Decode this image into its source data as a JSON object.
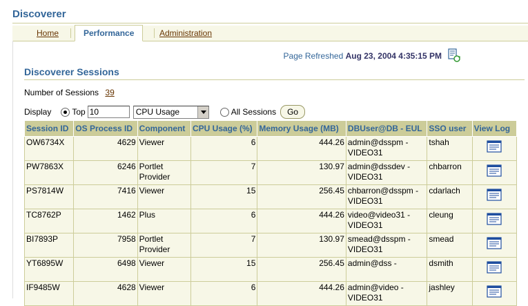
{
  "app": {
    "title": "Discoverer"
  },
  "tabs": [
    {
      "label": "Home",
      "active": false
    },
    {
      "label": "Performance",
      "active": true
    },
    {
      "label": "Administration",
      "active": false
    }
  ],
  "refresh": {
    "label": "Page Refreshed",
    "timestamp": "Aug 23, 2004 4:35:15 PM",
    "icon": "refresh-icon"
  },
  "section": {
    "title": "Discoverer Sessions"
  },
  "num_sessions": {
    "label": "Number of Sessions",
    "value": "39"
  },
  "display": {
    "label": "Display",
    "top_label": "Top",
    "top_value": "10",
    "sort_by": "CPU Usage",
    "all_label": "All Sessions",
    "go_label": "Go",
    "selected": "top"
  },
  "table": {
    "headers": [
      "Session ID",
      "OS Process ID",
      "Component",
      "CPU Usage (%)",
      "Memory Usage (MB)",
      "DBUser@DB - EUL",
      "SSO user",
      "View Log"
    ],
    "rows": [
      {
        "session_id": "OW6734X",
        "os_pid": "4629",
        "component": "Viewer",
        "cpu": "6",
        "memory": "444.26",
        "dbuser": "admin@dsspm - VIDEO31",
        "sso": "tshah"
      },
      {
        "session_id": "PW7863X",
        "os_pid": "6246",
        "component": "Portlet Provider",
        "cpu": "7",
        "memory": "130.97",
        "dbuser": "admin@dssdev - VIDEO31",
        "sso": "chbarron"
      },
      {
        "session_id": "PS7814W",
        "os_pid": "7416",
        "component": "Viewer",
        "cpu": "15",
        "memory": "256.45",
        "dbuser": "chbarron@dsspm - VIDEO31",
        "sso": "cdarlach"
      },
      {
        "session_id": "TC8762P",
        "os_pid": "1462",
        "component": "Plus",
        "cpu": "6",
        "memory": "444.26",
        "dbuser": "video@video31 - VIDEO31",
        "sso": "cleung"
      },
      {
        "session_id": "BI7893P",
        "os_pid": "7958",
        "component": "Portlet Provider",
        "cpu": "7",
        "memory": "130.97",
        "dbuser": "smead@dsspm - VIDEO31",
        "sso": "smead"
      },
      {
        "session_id": "YT6895W",
        "os_pid": "6498",
        "component": "Viewer",
        "cpu": "15",
        "memory": "256.45",
        "dbuser": "admin@dss -",
        "sso": "dsmith"
      },
      {
        "session_id": "IF9485W",
        "os_pid": "4628",
        "component": "Viewer",
        "cpu": "6",
        "memory": "444.26",
        "dbuser": "admin@video - VIDEO31",
        "sso": "jashley"
      }
    ]
  },
  "colors": {
    "accent": "#336699",
    "header_bg": "#cccc99",
    "row_bg": "#f7f7e7",
    "link": "#663300"
  }
}
